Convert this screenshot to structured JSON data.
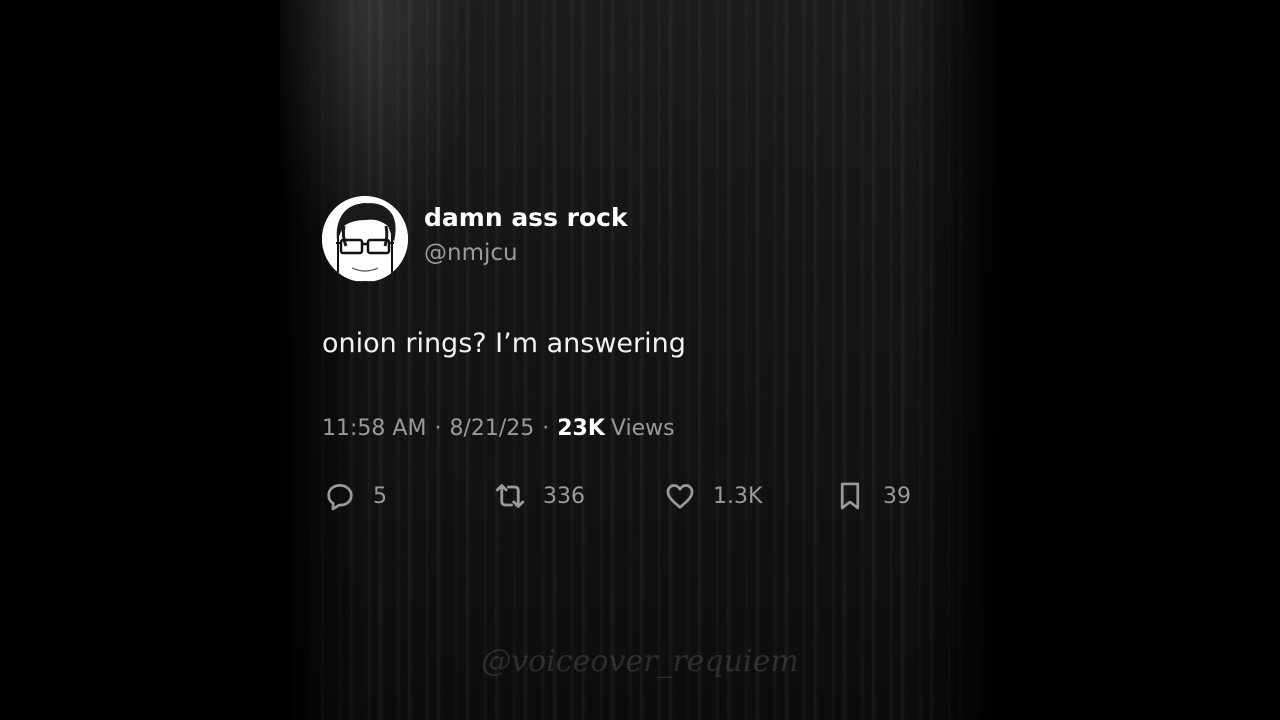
{
  "tweet": {
    "display_name": "damn ass rock",
    "handle": "@nmjcu",
    "text": "onion rings? I’m answering",
    "time": "11:58 AM",
    "date": "8/21/25",
    "separator": "·",
    "views_count": "23K",
    "views_label": "Views",
    "stats": {
      "replies": "5",
      "reposts": "336",
      "likes": "1.3K",
      "bookmarks": "39"
    }
  },
  "icons": {
    "reply": "reply-icon",
    "repost": "repost-icon",
    "like": "heart-icon",
    "bookmark": "bookmark-icon"
  },
  "watermark": "@voiceover_requiem",
  "colors": {
    "background": "#000000",
    "primary_text": "#ffffff",
    "secondary_text": "#9a9a9a"
  }
}
